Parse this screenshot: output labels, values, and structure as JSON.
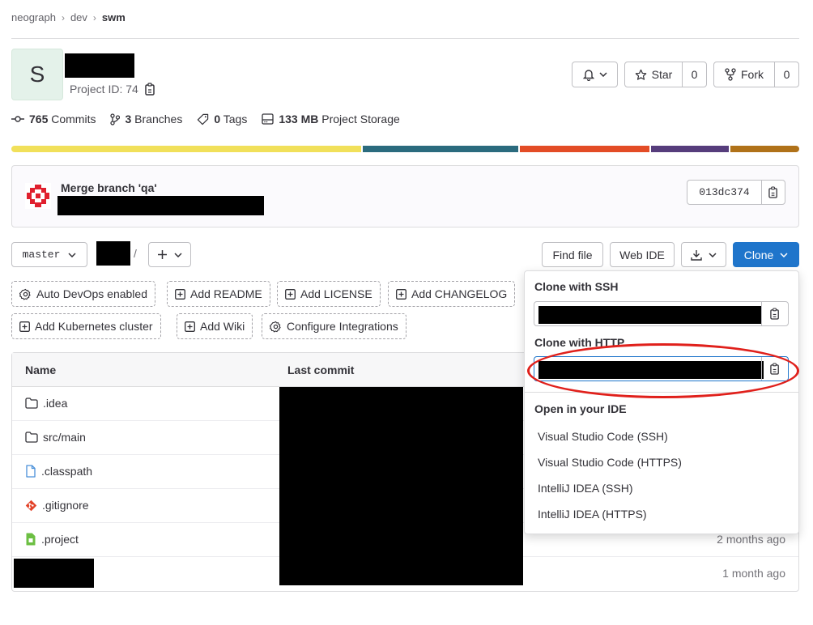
{
  "breadcrumb": {
    "items": [
      "neograph",
      "dev",
      "swm"
    ]
  },
  "project": {
    "avatar_letter": "S",
    "id_label": "Project ID: 74"
  },
  "header_actions": {
    "star_label": "Star",
    "star_count": "0",
    "fork_label": "Fork",
    "fork_count": "0"
  },
  "stats": [
    {
      "value": "765",
      "label": "Commits",
      "icon": "commit-icon"
    },
    {
      "value": "3",
      "label": "Branches",
      "icon": "branch-icon"
    },
    {
      "value": "0",
      "label": "Tags",
      "icon": "tag-icon"
    },
    {
      "value": "133 MB",
      "label": "Project Storage",
      "icon": "storage-icon"
    }
  ],
  "language_bar": {
    "colors": [
      "#f1e05a",
      "#2b6b7e",
      "#e34c26",
      "#563d7c",
      "#b07219"
    ]
  },
  "last_commit": {
    "title": "Merge branch 'qa'",
    "sha": "013dc374"
  },
  "toolbar": {
    "branch": "master",
    "path_sep": "/",
    "find_file": "Find file",
    "web_ide": "Web IDE",
    "clone": "Clone"
  },
  "quick_actions": [
    "Auto DevOps enabled",
    "Add README",
    "Add LICENSE",
    "Add CHANGELOG",
    "Add Kubernetes cluster",
    "Add Wiki",
    "Configure Integrations"
  ],
  "file_table": {
    "headers": {
      "name": "Name",
      "last_commit": "Last commit"
    },
    "rows": [
      {
        "name": ".idea",
        "icon": "folder-icon",
        "date": ""
      },
      {
        "name": "src/main",
        "icon": "folder-icon",
        "date": ""
      },
      {
        "name": ".classpath",
        "icon": "file-icon",
        "date": ""
      },
      {
        "name": ".gitignore",
        "icon": "git-icon",
        "date": ""
      },
      {
        "name": ".project",
        "icon": "file-icon",
        "date": "2 months ago"
      },
      {
        "name": "",
        "icon": "",
        "date": "1 month ago"
      }
    ]
  },
  "clone_dropdown": {
    "ssh_label": "Clone with SSH",
    "http_label": "Clone with HTTP",
    "ide_label": "Open in your IDE",
    "ide_items": [
      "Visual Studio Code (SSH)",
      "Visual Studio Code (HTTPS)",
      "IntelliJ IDEA (SSH)",
      "IntelliJ IDEA (HTTPS)"
    ]
  },
  "annotation_color": "#e0201b"
}
